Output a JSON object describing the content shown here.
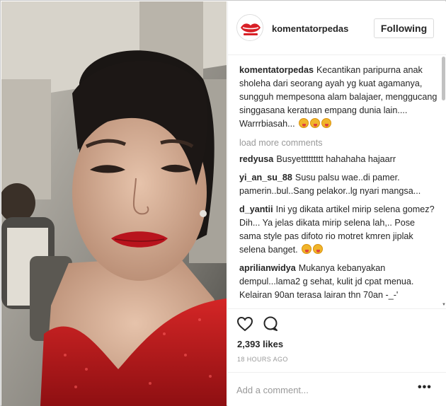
{
  "post": {
    "username": "komentatorpedas",
    "follow_label": "Following",
    "caption": {
      "username": "komentatorpedas",
      "text": "Kecantikan paripurna anak sholeha dari seorang ayah yg kuat agamanya, sungguh mempesona alam balajaer, menggucang singgasana keratuan empang dunia lain.... Warrrbiasah..."
    },
    "load_more_label": "load more comments",
    "comments": [
      {
        "username": "redyusa",
        "text": "Busyettttttttt hahahaha hajaarr"
      },
      {
        "username": "yi_an_su_88",
        "text": "Susu palsu wae..di pamer. pamerin..bul..Sang pelakor..lg nyari mangsa..."
      },
      {
        "username": "d_yantii",
        "text": "Ini yg dikata artikel mirip selena gomez? Dih... Ya jelas dikata mirip selena lah,.. Pose sama style pas difoto rio motret kmren jiplak selena banget."
      },
      {
        "username": "aprilianwidya",
        "text": "Mukanya kebanyakan dempul...lama2 g sehat, kulit jd cpat menua. Kelairan 90an terasa lairan thn 70an -_-'"
      }
    ],
    "likes": "2,393 likes",
    "timestamp": "18 HOURS AGO",
    "add_comment_placeholder": "Add a comment...",
    "more_label": "•••"
  },
  "icons": {
    "like": "heart-icon",
    "comment": "comment-bubble-icon",
    "more": "more-options-icon",
    "avatar": "red-lips-logo"
  },
  "colors": {
    "text": "#262626",
    "muted": "#999999",
    "border": "#efefef",
    "lips": "#d81f26"
  }
}
